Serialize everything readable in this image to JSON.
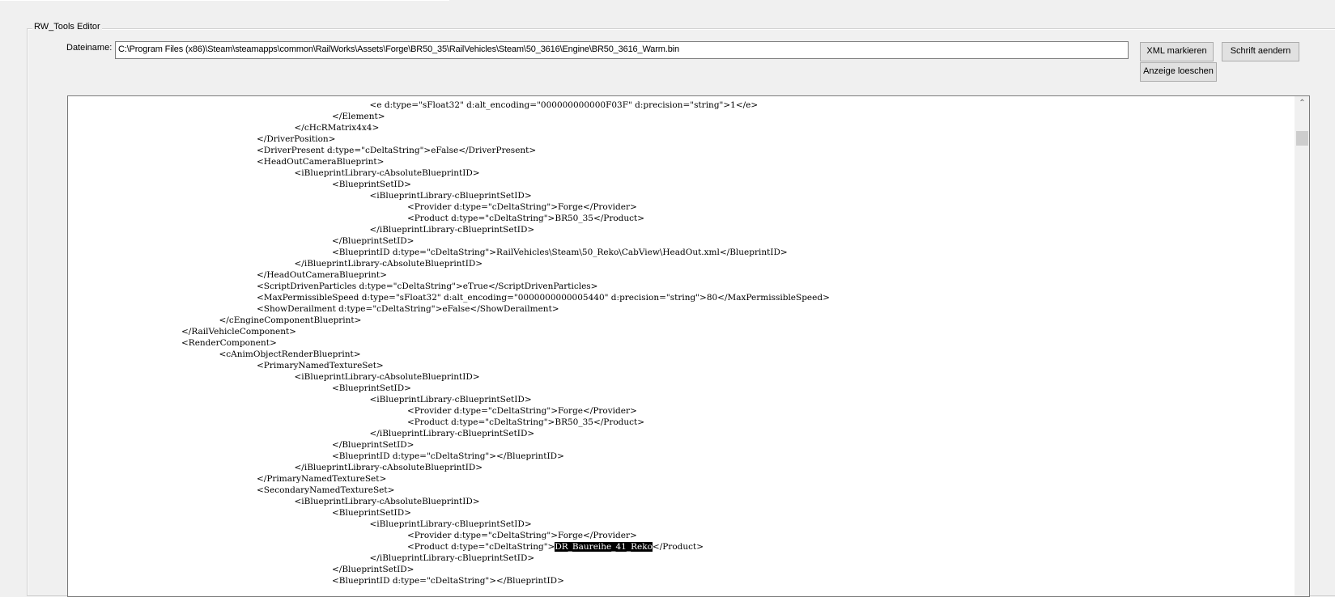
{
  "window": {
    "group_title": "RW_Tools Editor"
  },
  "file": {
    "label": "Dateiname:",
    "path": "C:\\Program Files (x86)\\Steam\\steamapps\\common\\RailWorks\\Assets\\Forge\\BR50_35\\RailVehicles\\Steam\\50_3616\\Engine\\BR50_3616_Warm.bin"
  },
  "buttons": {
    "xml_markieren": "XML markieren",
    "schrift_aendern": "Schrift aendern",
    "anzeige_loeschen": "Anzeige loeschen"
  },
  "scrollbar": {
    "up_glyph": "⌃"
  },
  "xml_lines": [
    {
      "indent": 5,
      "text": "<e d:type=\"sFloat32\" d:alt_encoding=\"000000000000F03F\" d:precision=\"string\">1</e>"
    },
    {
      "indent": 4,
      "text": "</Element>"
    },
    {
      "indent": 3,
      "text": "</cHcRMatrix4x4>"
    },
    {
      "indent": 2,
      "text": "</DriverPosition>"
    },
    {
      "indent": 2,
      "text": "<DriverPresent d:type=\"cDeltaString\">eFalse</DriverPresent>"
    },
    {
      "indent": 2,
      "text": "<HeadOutCameraBlueprint>"
    },
    {
      "indent": 3,
      "text": "<iBlueprintLibrary-cAbsoluteBlueprintID>"
    },
    {
      "indent": 4,
      "text": "<BlueprintSetID>"
    },
    {
      "indent": 5,
      "text": "<iBlueprintLibrary-cBlueprintSetID>"
    },
    {
      "indent": 6,
      "text": "<Provider d:type=\"cDeltaString\">Forge</Provider>"
    },
    {
      "indent": 6,
      "text": "<Product d:type=\"cDeltaString\">BR50_35</Product>"
    },
    {
      "indent": 5,
      "text": "</iBlueprintLibrary-cBlueprintSetID>"
    },
    {
      "indent": 4,
      "text": "</BlueprintSetID>"
    },
    {
      "indent": 4,
      "text": "<BlueprintID d:type=\"cDeltaString\">RailVehicles\\Steam\\50_Reko\\CabView\\HeadOut.xml</BlueprintID>"
    },
    {
      "indent": 3,
      "text": "</iBlueprintLibrary-cAbsoluteBlueprintID>"
    },
    {
      "indent": 2,
      "text": "</HeadOutCameraBlueprint>"
    },
    {
      "indent": 2,
      "text": "<ScriptDrivenParticles d:type=\"cDeltaString\">eTrue</ScriptDrivenParticles>"
    },
    {
      "indent": 2,
      "text": "<MaxPermissibleSpeed d:type=\"sFloat32\" d:alt_encoding=\"0000000000005440\" d:precision=\"string\">80</MaxPermissibleSpeed>"
    },
    {
      "indent": 2,
      "text": "<ShowDerailment d:type=\"cDeltaString\">eFalse</ShowDerailment>"
    },
    {
      "indent": 1,
      "text": "</cEngineComponentBlueprint>"
    },
    {
      "indent": 0,
      "text": "</RailVehicleComponent>"
    },
    {
      "indent": 0,
      "text": "<RenderComponent>"
    },
    {
      "indent": 1,
      "text": "<cAnimObjectRenderBlueprint>"
    },
    {
      "indent": 2,
      "text": "<PrimaryNamedTextureSet>"
    },
    {
      "indent": 3,
      "text": "<iBlueprintLibrary-cAbsoluteBlueprintID>"
    },
    {
      "indent": 4,
      "text": "<BlueprintSetID>"
    },
    {
      "indent": 5,
      "text": "<iBlueprintLibrary-cBlueprintSetID>"
    },
    {
      "indent": 6,
      "text": "<Provider d:type=\"cDeltaString\">Forge</Provider>"
    },
    {
      "indent": 6,
      "text": "<Product d:type=\"cDeltaString\">BR50_35</Product>"
    },
    {
      "indent": 5,
      "text": "</iBlueprintLibrary-cBlueprintSetID>"
    },
    {
      "indent": 4,
      "text": "</BlueprintSetID>"
    },
    {
      "indent": 4,
      "text": "<BlueprintID d:type=\"cDeltaString\"></BlueprintID>"
    },
    {
      "indent": 3,
      "text": "</iBlueprintLibrary-cAbsoluteBlueprintID>"
    },
    {
      "indent": 2,
      "text": "</PrimaryNamedTextureSet>"
    },
    {
      "indent": 2,
      "text": "<SecondaryNamedTextureSet>"
    },
    {
      "indent": 3,
      "text": "<iBlueprintLibrary-cAbsoluteBlueprintID>"
    },
    {
      "indent": 4,
      "text": "<BlueprintSetID>"
    },
    {
      "indent": 5,
      "text": "<iBlueprintLibrary-cBlueprintSetID>"
    },
    {
      "indent": 6,
      "text": "<Provider d:type=\"cDeltaString\">Forge</Provider>"
    },
    {
      "indent": 6,
      "text": "<Product d:type=\"cDeltaString\">",
      "selected": "DR_Baureihe_41_Reko",
      "after": "</Product>"
    },
    {
      "indent": 5,
      "text": "</iBlueprintLibrary-cBlueprintSetID>"
    },
    {
      "indent": 4,
      "text": "</BlueprintSetID>"
    },
    {
      "indent": 4,
      "text": "<BlueprintID d:type=\"cDeltaString\"></BlueprintID>"
    }
  ]
}
